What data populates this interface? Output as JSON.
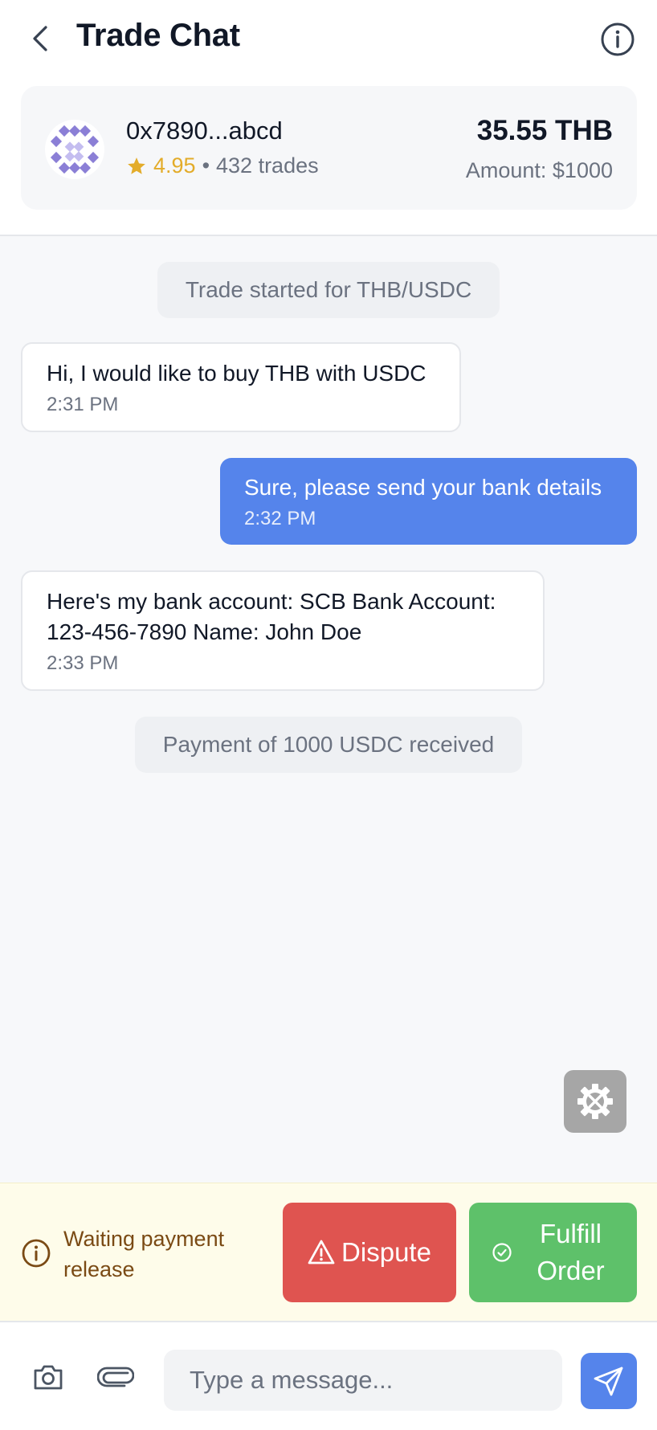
{
  "header": {
    "title": "Trade Chat",
    "back_icon": "chevron-left-icon",
    "info_icon": "info-icon"
  },
  "trader": {
    "address": "0x7890...abcd",
    "rating": "4.95",
    "separator": "•",
    "trades": "432 trades",
    "price": "35.55 THB",
    "amount": "Amount: $1000",
    "avatar_icon": "identicon-avatar"
  },
  "messages": {
    "system_1": "Trade started for THB/USDC",
    "m1": {
      "text": "Hi, I would like to buy THB with USDC",
      "time": "2:31 PM",
      "direction": "incoming"
    },
    "m2": {
      "text": "Sure, please send your bank details",
      "time": "2:32 PM",
      "direction": "outgoing"
    },
    "m3": {
      "text": "Here's my bank account: SCB Bank Account: 123-456-7890 Name: John Doe",
      "time": "2:33 PM",
      "direction": "incoming"
    },
    "system_2": "Payment of 1000 USDC received"
  },
  "support_icon": "support-gear-icon",
  "status": {
    "text": "Waiting payment release",
    "icon": "info-circle-icon"
  },
  "actions": {
    "dispute_label": "Dispute",
    "fulfill_label": "Fulfill Order"
  },
  "composer": {
    "placeholder": "Type a message...",
    "camera_icon": "camera-icon",
    "attach_icon": "paperclip-icon",
    "send_icon": "send-icon"
  },
  "colors": {
    "accent_blue": "#5584eb",
    "dispute_red": "#df5450",
    "fulfill_green": "#5ec16a",
    "rating_gold": "#e3ac2a",
    "status_brown": "#7a4a14"
  }
}
